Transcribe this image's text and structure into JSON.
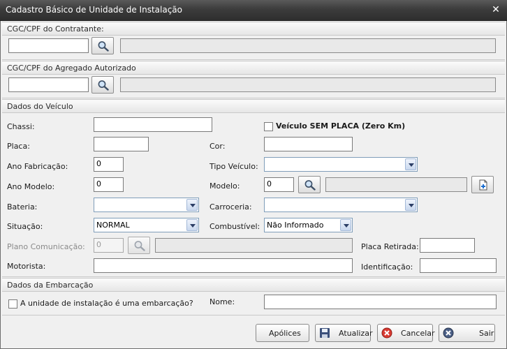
{
  "window": {
    "title": "Cadastro Básico de Unidade de Instalação"
  },
  "sections": {
    "contratante": "CGC/CPF do Contratante:",
    "agregado": "CGC/CPF do Agregado Autorizado",
    "veiculo": "Dados do Veículo",
    "embarcacao": "Dados da Embarcação"
  },
  "veiculo": {
    "chassi_label": "Chassi:",
    "sem_placa_label": "Veículo SEM PLACA (Zero Km)",
    "placa_label": "Placa:",
    "cor_label": "Cor:",
    "ano_fab_label": "Ano Fabricação:",
    "ano_fab_value": "0",
    "tipo_label": "Tipo Veículo:",
    "ano_modelo_label": "Ano Modelo:",
    "ano_modelo_value": "0",
    "modelo_label": "Modelo:",
    "modelo_value": "0",
    "bateria_label": "Bateria:",
    "carroceria_label": "Carroceria:",
    "situacao_label": "Situação:",
    "situacao_value": "NORMAL",
    "combustivel_label": "Combustível:",
    "combustivel_value": "Não Informado",
    "plano_label": "Plano Comunicação:",
    "plano_value": "0",
    "placa_retirada_label": "Placa Retirada:",
    "motorista_label": "Motorista:",
    "identificacao_label": "Identificação:"
  },
  "embarcacao": {
    "checkbox_label": "A unidade de instalação é uma embarcação?",
    "nome_label": "Nome:"
  },
  "buttons": {
    "apolices": "Apólices",
    "atualizar": "Atualizar",
    "cancelar": "Cancelar",
    "sair": "Sair"
  },
  "icons": {
    "search": "magnifier-icon",
    "close": "close-x-icon",
    "add": "add-document-icon",
    "save": "floppy-disk-icon",
    "cancel": "red-cancel-icon",
    "exit": "exit-circle-icon"
  }
}
